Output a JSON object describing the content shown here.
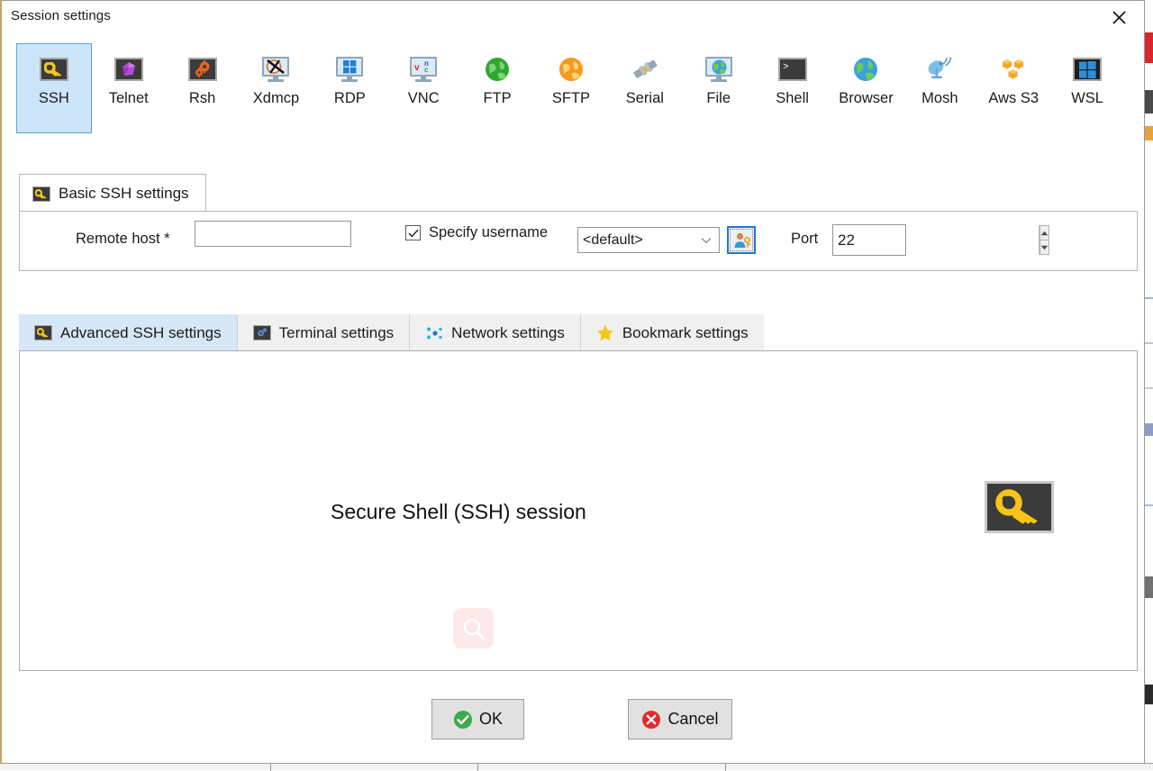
{
  "window": {
    "title": "Session settings",
    "close_icon": "close-icon"
  },
  "protocols": {
    "selected": "SSH",
    "items": [
      {
        "label": "SSH",
        "icon": "key-icon"
      },
      {
        "label": "Telnet",
        "icon": "purple-cube-icon"
      },
      {
        "label": "Rsh",
        "icon": "orange-gears-icon"
      },
      {
        "label": "Xdmcp",
        "icon": "x-monitor-icon"
      },
      {
        "label": "RDP",
        "icon": "windows-monitor-icon"
      },
      {
        "label": "VNC",
        "icon": "vnc-monitor-icon"
      },
      {
        "label": "FTP",
        "icon": "green-globe-icon"
      },
      {
        "label": "SFTP",
        "icon": "orange-globe-icon"
      },
      {
        "label": "Serial",
        "icon": "plug-connector-icon"
      },
      {
        "label": "File",
        "icon": "globe-monitor-icon"
      },
      {
        "label": "Shell",
        "icon": "terminal-prompt-icon"
      },
      {
        "label": "Browser",
        "icon": "blue-globe-icon"
      },
      {
        "label": "Mosh",
        "icon": "satellite-dish-icon"
      },
      {
        "label": "Aws S3",
        "icon": "aws-cubes-icon"
      },
      {
        "label": "WSL",
        "icon": "windows-logo-icon"
      }
    ]
  },
  "basic_settings": {
    "tab_label": "Basic SSH settings",
    "tab_icon": "key-icon",
    "remote_host_label": "Remote host *",
    "remote_host_value": "",
    "remote_host_placeholder": "",
    "specify_username_label": "Specify username",
    "specify_username_checked": true,
    "username_value": "<default>",
    "username_caret_icon": "chevron-down-icon",
    "user_key_button_icon": "user-key-icon",
    "port_label": "Port",
    "port_value": "22",
    "spinner_up_icon": "caret-up-icon",
    "spinner_down_icon": "caret-down-icon"
  },
  "subtabs": {
    "active": "Advanced SSH settings",
    "items": [
      {
        "label": "Advanced SSH settings",
        "icon": "key-icon"
      },
      {
        "label": "Terminal settings",
        "icon": "terminal-gear-icon"
      },
      {
        "label": "Network settings",
        "icon": "network-nodes-icon"
      },
      {
        "label": "Bookmark settings",
        "icon": "star-icon"
      }
    ]
  },
  "content": {
    "description": "Secure Shell (SSH) session",
    "session_icon": "key-icon",
    "watermark_icon": "search-icon"
  },
  "footer": {
    "ok_label": "OK",
    "ok_icon": "check-circle-icon",
    "cancel_label": "Cancel",
    "cancel_icon": "x-circle-icon"
  },
  "colors": {
    "selection_blue": "#cce5f9",
    "active_tab_blue": "#d6e7f7",
    "accent_border": "#5c9fd8",
    "key_yellow": "#f5c518",
    "ok_green": "#3cab4a",
    "cancel_red": "#e02b2b"
  }
}
